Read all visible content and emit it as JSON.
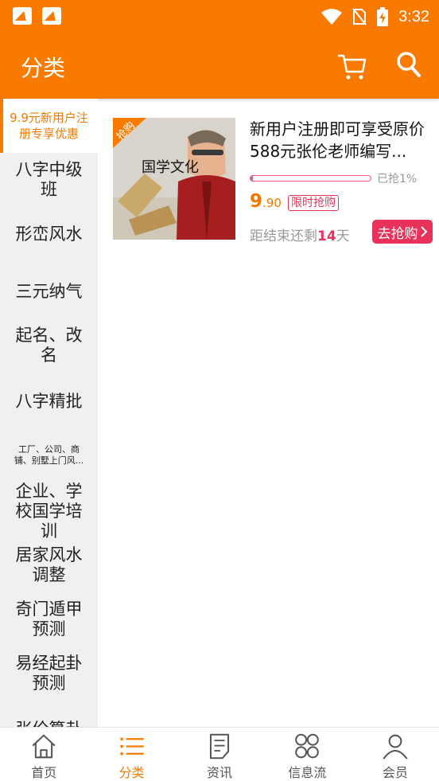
{
  "status_bar": {
    "time": "3:32",
    "icons": [
      "app-notification-icon",
      "app-notification-icon",
      "wifi-icon",
      "no-sim-icon",
      "battery-charging-icon"
    ]
  },
  "app_bar": {
    "title": "分类",
    "cart_icon": "cart-icon",
    "search_icon": "search-icon",
    "color": "#fa7a00"
  },
  "sidebar": {
    "items": [
      {
        "label": "9.9元新用户注册专享优惠",
        "active": true
      },
      {
        "label": "八字中级班"
      },
      {
        "label": "形峦风水"
      },
      {
        "label": "三元纳气"
      },
      {
        "label": "起名、改名"
      },
      {
        "label": "八字精批"
      },
      {
        "label": "工厂、公司、商铺、别墅上门风..."
      },
      {
        "label": "企业、学校国学培训"
      },
      {
        "label": "居家风水调整"
      },
      {
        "label": "奇门遁甲预测"
      },
      {
        "label": "易经起卦预测"
      },
      {
        "label": "张伦算卦"
      }
    ]
  },
  "product": {
    "badge": "抢购",
    "image_caption": "国学文化",
    "title": "新用户注册即可享受原价588元张伦老师编写...",
    "sold_label": "已抢1%",
    "sold_percent": 1,
    "price_int": "9",
    "price_dec": ".90",
    "tag": "限时抢购",
    "remain_prefix": "距结束还剩",
    "remain_days": "14",
    "remain_suffix": "天",
    "buy_label": "去抢购"
  },
  "bottom_nav": {
    "items": [
      {
        "label": "首页",
        "icon": "home-icon"
      },
      {
        "label": "分类",
        "icon": "category-list-icon",
        "active": true
      },
      {
        "label": "资讯",
        "icon": "news-icon"
      },
      {
        "label": "信息流",
        "icon": "feed-grid-icon"
      },
      {
        "label": "会员",
        "icon": "member-icon"
      }
    ]
  },
  "colors": {
    "accent": "#fa7a00",
    "highlight": "#e8325a",
    "sidebar_bg": "#f0f0f0"
  }
}
